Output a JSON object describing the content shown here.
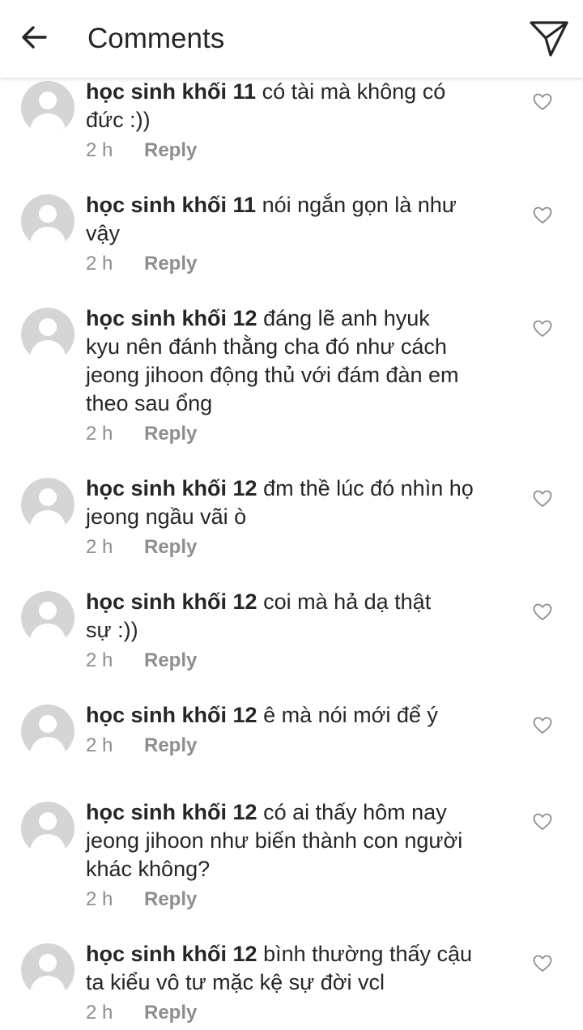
{
  "header": {
    "title": "Comments"
  },
  "comments": [
    {
      "username": "học sinh khối 11",
      "text": "có tài mà không có đức :))",
      "lines": [
        "có tài mà không có",
        "đức :))"
      ],
      "time": "2 h",
      "reply": "Reply"
    },
    {
      "username": "học sinh khối 11",
      "text": "nói ngắn gọn là như vậy",
      "lines": [
        "nói ngắn gọn là như",
        "vậy"
      ],
      "time": "2 h",
      "reply": "Reply"
    },
    {
      "username": "học sinh khối 12",
      "text": "đáng lẽ anh hyuk kyu nên đánh thằng cha đó như cách jeong jihoon động thủ với đám đàn em theo sau ổng",
      "lines": [
        "đáng lẽ anh hyuk",
        "kyu nên đánh thằng cha đó như cách",
        "jeong jihoon động thủ với đám đàn em",
        "theo sau ổng"
      ],
      "time": "2 h",
      "reply": "Reply"
    },
    {
      "username": "học sinh khối 12",
      "text": "đm thề lúc đó nhìn họ jeong ngầu vãi ò",
      "lines": [
        "đm thề lúc đó nhìn họ",
        "jeong ngầu vãi ò"
      ],
      "time": "2 h",
      "reply": "Reply"
    },
    {
      "username": "học sinh khối 12",
      "text": "coi mà hả dạ thật sự :))",
      "lines": [
        "coi mà hả dạ thật",
        "sự :))"
      ],
      "time": "2 h",
      "reply": "Reply"
    },
    {
      "username": "học sinh khối 12",
      "text": "ê mà nói mới để ý",
      "lines": [
        "ê mà nói mới để ý"
      ],
      "time": "2 h",
      "reply": "Reply"
    },
    {
      "username": "học sinh khối 12",
      "text": "có ai thấy hôm nay jeong jihoon như biến thành con người khác không?",
      "lines": [
        "có ai thấy hôm nay",
        "jeong jihoon như biến thành con người",
        "khác không?"
      ],
      "time": "2 h",
      "reply": "Reply"
    },
    {
      "username": "học sinh khối 12",
      "text": "bình thường thấy cậu ta kiểu vô tư mặc kệ sự đời vcl",
      "lines": [
        "bình thường thấy cậu",
        "ta kiểu vô tư mặc kệ sự đời vcl"
      ],
      "time": "2 h",
      "reply": "Reply"
    }
  ]
}
